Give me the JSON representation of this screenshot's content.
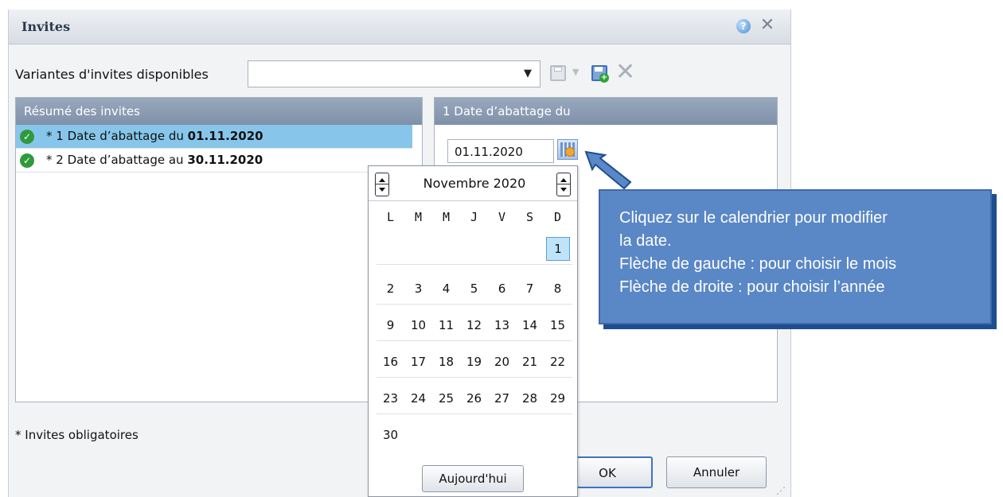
{
  "dialog": {
    "title": "Invites",
    "help_icon": "help-icon",
    "close_icon": "close-icon",
    "close_glyph": "✕",
    "help_glyph": "?"
  },
  "variants": {
    "label": "Variantes d'invites disponibles",
    "value": "",
    "dropdown_glyph": "▼",
    "small_dropdown_glyph": "▼",
    "delete_glyph": "✕"
  },
  "summary_panel": {
    "header": "Résumé des invites",
    "items": [
      {
        "prefix": "* 1 Date d’abattage du ",
        "value": "01.11.2020",
        "selected": true
      },
      {
        "prefix": "* 2 Date d’abattage au ",
        "value": "30.11.2020",
        "selected": false
      }
    ]
  },
  "detail_panel": {
    "header": "1 Date d’abattage du",
    "date_value": "01.11.2020"
  },
  "calendar": {
    "month_year": "Novembre 2020",
    "weekdays": [
      "L",
      "M",
      "M",
      "J",
      "V",
      "S",
      "D"
    ],
    "weeks": [
      [
        "",
        "",
        "",
        "",
        "",
        "",
        "1"
      ],
      [
        "2",
        "3",
        "4",
        "5",
        "6",
        "7",
        "8"
      ],
      [
        "9",
        "10",
        "11",
        "12",
        "13",
        "14",
        "15"
      ],
      [
        "16",
        "17",
        "18",
        "19",
        "20",
        "21",
        "22"
      ],
      [
        "23",
        "24",
        "25",
        "26",
        "27",
        "28",
        "29"
      ],
      [
        "30",
        "",
        "",
        "",
        "",
        "",
        ""
      ]
    ],
    "selected_day": "1",
    "today_button": "Aujourd'hui"
  },
  "footer": {
    "required_note": "* Invites obligatoires",
    "ok_label": "OK",
    "cancel_label": "Annuler"
  },
  "callout": {
    "lines": [
      "Cliquez sur le calendrier pour modifier",
      "la date.",
      "Flèche de gauche : pour choisir le mois",
      "Flèche de droite : pour choisir l’année"
    ]
  },
  "colors": {
    "panel_header": "#8a9bb2",
    "selected_row": "#87c6ea",
    "callout_bg": "#5a87c6",
    "callout_shadow": "#1f4e8f",
    "ok_border": "#3d74c7"
  }
}
